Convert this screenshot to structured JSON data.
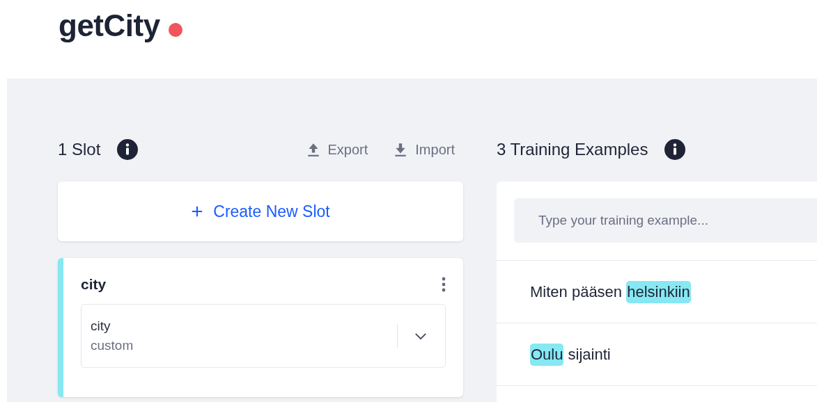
{
  "header": {
    "title": "getCity",
    "unsaved": true
  },
  "slots_panel": {
    "heading": "1 Slot",
    "actions": [
      {
        "label": "Export",
        "kind": "export"
      },
      {
        "label": "Import",
        "kind": "import"
      }
    ],
    "create_button": "Create New Slot",
    "slots": [
      {
        "name": "city",
        "entity": "city",
        "type": "custom",
        "color": "#86e8f2"
      }
    ]
  },
  "examples_panel": {
    "heading": "3 Training Examples",
    "input": {
      "placeholder": "Type your training example..."
    },
    "examples": [
      {
        "segments": [
          {
            "text": "Miten pääsen ",
            "slot": false
          },
          {
            "text": "helsinkiin",
            "slot": true
          }
        ]
      },
      {
        "segments": [
          {
            "text": "Oulu",
            "slot": true
          },
          {
            "text": " sijainti",
            "slot": false
          }
        ]
      }
    ]
  }
}
